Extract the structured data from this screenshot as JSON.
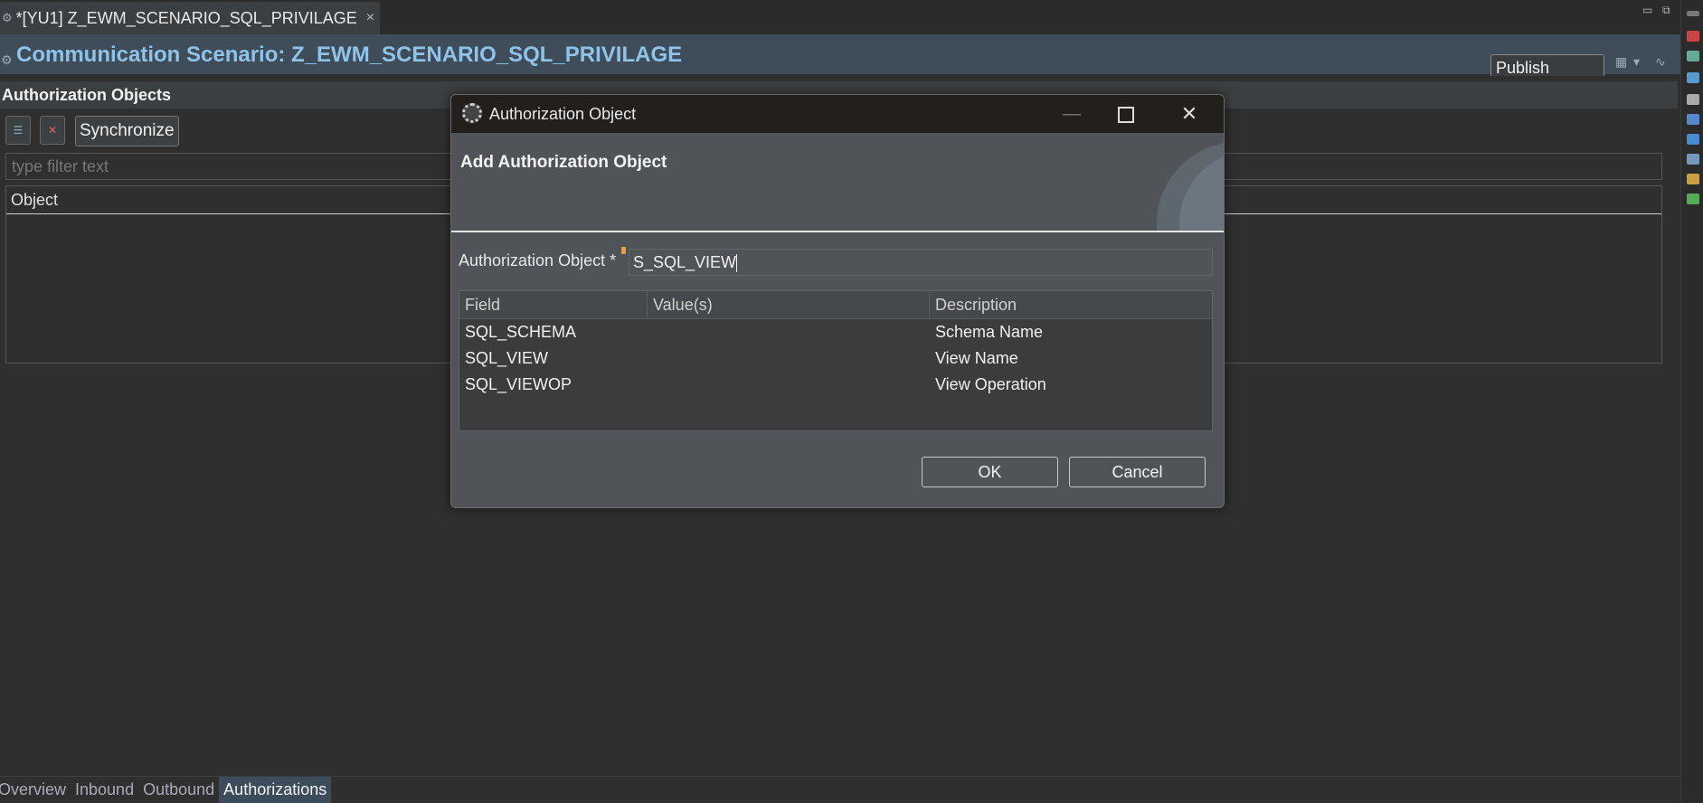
{
  "editor_tab": {
    "icon": "scenario-icon",
    "label": "*[YU1] Z_EWM_SCENARIO_SQL_PRIVILAGE",
    "close": "×"
  },
  "window_controls": {
    "minimize": "▭",
    "restore": "⧉"
  },
  "header": {
    "title": "Communication Scenario: Z_EWM_SCENARIO_SQL_PRIVILAGE",
    "publish_label": "Publish Locally"
  },
  "section": {
    "title": "Authorization Objects",
    "sync_label": "Synchronize",
    "filter_placeholder": "type filter text",
    "column_object": "Object"
  },
  "bottom_tabs": [
    {
      "label": "Overview",
      "active": false
    },
    {
      "label": "Inbound",
      "active": false
    },
    {
      "label": "Outbound",
      "active": false
    },
    {
      "label": "Authorizations",
      "active": true
    }
  ],
  "dialog": {
    "title": "Authorization Object",
    "heading": "Add Authorization Object",
    "field_label": "Authorization Object *",
    "field_value": "S_SQL_VIEW",
    "controls": {
      "minimize": "—",
      "maximize": "☐",
      "close": "✕"
    },
    "table": {
      "headers": [
        "Field",
        "Value(s)",
        "Description"
      ],
      "rows": [
        {
          "field": "SQL_SCHEMA",
          "values": "",
          "description": "Schema Name"
        },
        {
          "field": "SQL_VIEW",
          "values": "",
          "description": "View Name"
        },
        {
          "field": "SQL_VIEWOP",
          "values": "",
          "description": "View Operation"
        }
      ]
    },
    "ok_label": "OK",
    "cancel_label": "Cancel"
  },
  "colors": {
    "title_blue": "#8fc3ea",
    "header_bg": "#3f4d5a",
    "dialog_bg": "#505458",
    "titlebar_bg": "#231f1d"
  }
}
